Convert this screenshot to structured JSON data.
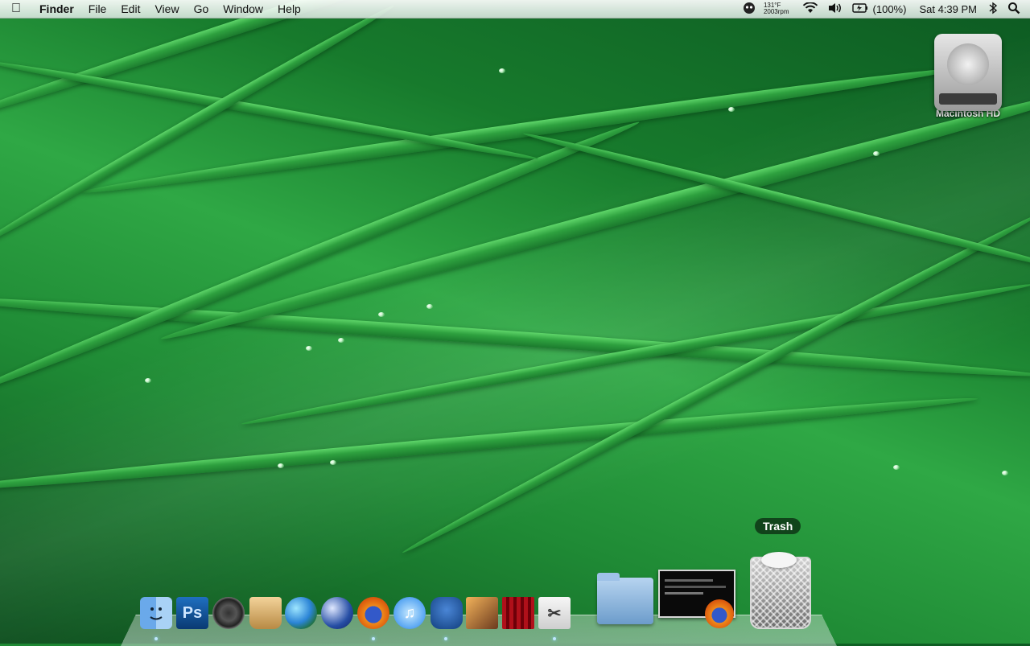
{
  "menubar": {
    "app_menu": "Finder",
    "menus": [
      "File",
      "Edit",
      "View",
      "Go",
      "Window",
      "Help"
    ],
    "status": {
      "temperature": "131°F",
      "fan": "2003rpm",
      "battery": "(100%)",
      "clock": "Sat 4:39 PM"
    },
    "icons": [
      "apple-icon",
      "gremlin-icon",
      "wifi-icon",
      "volume-icon",
      "battery-icon",
      "bluetooth-icon",
      "spotlight-icon"
    ]
  },
  "desktop": {
    "drive_label": "Macintosh HD"
  },
  "dock": {
    "tooltip": "Trash",
    "ps_label": "Ps",
    "apps": [
      "finder-icon",
      "photoshop-icon",
      "camera-lens-icon",
      "bucket-icon",
      "globe-icon",
      "google-earth-icon",
      "firefox-icon",
      "itunes-icon",
      "bird-icon",
      "photo-camera-icon",
      "curtain-icon",
      "scissors-icon"
    ],
    "stacks": [
      "folder-stack-icon",
      "screenshot-stack-icon",
      "trash-icon"
    ]
  },
  "colors": {
    "grass_dark": "#0b4d1c",
    "grass_light": "#2fa845"
  }
}
